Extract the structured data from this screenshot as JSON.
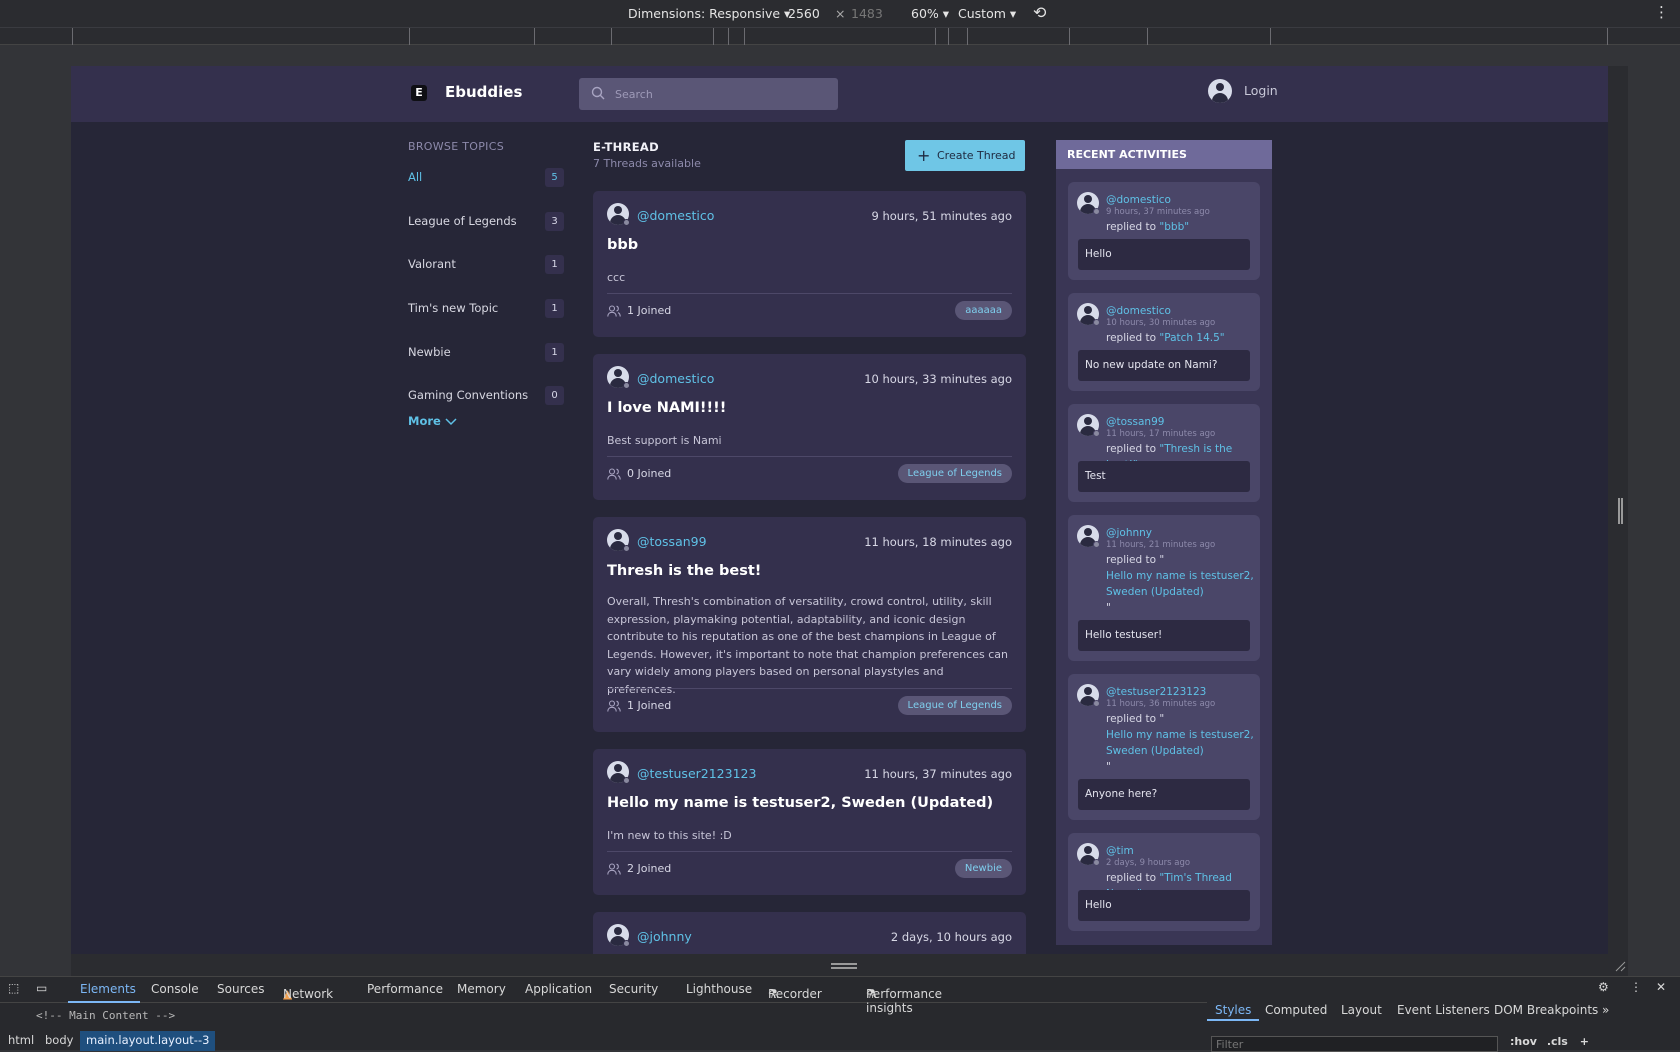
{
  "devtools_toolbar": {
    "dimensions_label": "Dimensions: Responsive",
    "width": "2560",
    "times": "×",
    "height": "1483",
    "zoom": "60%",
    "throttle": "Custom"
  },
  "header": {
    "logo_letter": "E",
    "brand": "Ebuddies",
    "search_placeholder": "Search",
    "login": "Login"
  },
  "sidebar": {
    "heading": "BROWSE TOPICS",
    "topics": [
      {
        "label": "All",
        "count": "5"
      },
      {
        "label": "League of Legends",
        "count": "3"
      },
      {
        "label": "Valorant",
        "count": "1"
      },
      {
        "label": "Tim's new Topic",
        "count": "1"
      },
      {
        "label": "Newbie",
        "count": "1"
      },
      {
        "label": "Gaming Conventions",
        "count": "0"
      }
    ],
    "more": "More"
  },
  "threads_header": {
    "title": "E-THREAD",
    "subtitle": "7 Threads available",
    "create_button": "Create Thread"
  },
  "threads": [
    {
      "user": "@domestico",
      "time": "9 hours, 51 minutes ago",
      "title": "bbb",
      "body": "ccc",
      "joined": "1 Joined",
      "tag": "aaaaaa"
    },
    {
      "user": "@domestico",
      "time": "10 hours, 33 minutes ago",
      "title": "I love NAMI!!!!",
      "body": "Best support is Nami",
      "joined": "0 Joined",
      "tag": "League of Legends"
    },
    {
      "user": "@tossan99",
      "time": "11 hours, 18 minutes ago",
      "title": "Thresh is the best!",
      "body": "Overall, Thresh's combination of versatility, crowd control, utility, skill expression, playmaking potential, adaptability, and iconic design contribute to his reputation as one of the best champions in League of Legends. However, it's important to note that champion preferences can vary widely among players based on personal playstyles and preferences.",
      "joined": "1 Joined",
      "tag": "League of Legends"
    },
    {
      "user": "@testuser2123123",
      "time": "11 hours, 37 minutes ago",
      "title": "Hello my name is testuser2, Sweden (Updated)",
      "body": "I'm new to this site! :D",
      "joined": "2 Joined",
      "tag": "Newbie"
    },
    {
      "user": "@johnny",
      "time": "2 days, 10 hours ago"
    }
  ],
  "recent": {
    "heading": "RECENT ACTIVITIES",
    "items": [
      {
        "user": "@domestico",
        "time": "9 hours, 37 minutes ago",
        "replied": "replied to",
        "target": "\"bbb\"",
        "message": "Hello"
      },
      {
        "user": "@domestico",
        "time": "10 hours, 30 minutes ago",
        "replied": "replied to",
        "target": "\"Patch 14.5\"",
        "message": "No new update on Nami?"
      },
      {
        "user": "@tossan99",
        "time": "11 hours, 17 minutes ago",
        "replied": "replied to",
        "target": "\"Thresh is the best!\"",
        "message": "Test"
      },
      {
        "user": "@johnny",
        "time": "11 hours, 21 minutes ago",
        "replied": "replied to \"",
        "target": "Hello my name is testuser2, Sweden (Updated)",
        "close": "\"",
        "message": "Hello testuser!"
      },
      {
        "user": "@testuser2123123",
        "time": "11 hours, 36 minutes ago",
        "replied": "replied to \"",
        "target": "Hello my name is testuser2, Sweden (Updated)",
        "close": "\"",
        "message": "Anyone here?"
      },
      {
        "user": "@tim",
        "time": "2 days, 9 hours ago",
        "replied": "replied to",
        "target": "\"Tim's Thread Name\"",
        "message": "Hello"
      }
    ]
  },
  "devtools": {
    "tabs": [
      "Elements",
      "Console",
      "Sources",
      "Network",
      "Performance",
      "Memory",
      "Application",
      "Security",
      "Lighthouse",
      "Recorder",
      "Performance insights"
    ],
    "code_line": "<!-- Main Content -->",
    "breadcrumbs": [
      "html",
      "body",
      "main.layout.layout--3"
    ],
    "side_tabs": [
      "Styles",
      "Computed",
      "Layout",
      "Event Listeners",
      "DOM Breakpoints"
    ],
    "filter_placeholder": "Filter",
    "hov": ":hov",
    "cls": ".cls"
  },
  "colors": {
    "accent": "#5fc1e6",
    "card_bg": "#34304d",
    "page_bg": "#262637",
    "create_button": "#6fc6e6"
  }
}
